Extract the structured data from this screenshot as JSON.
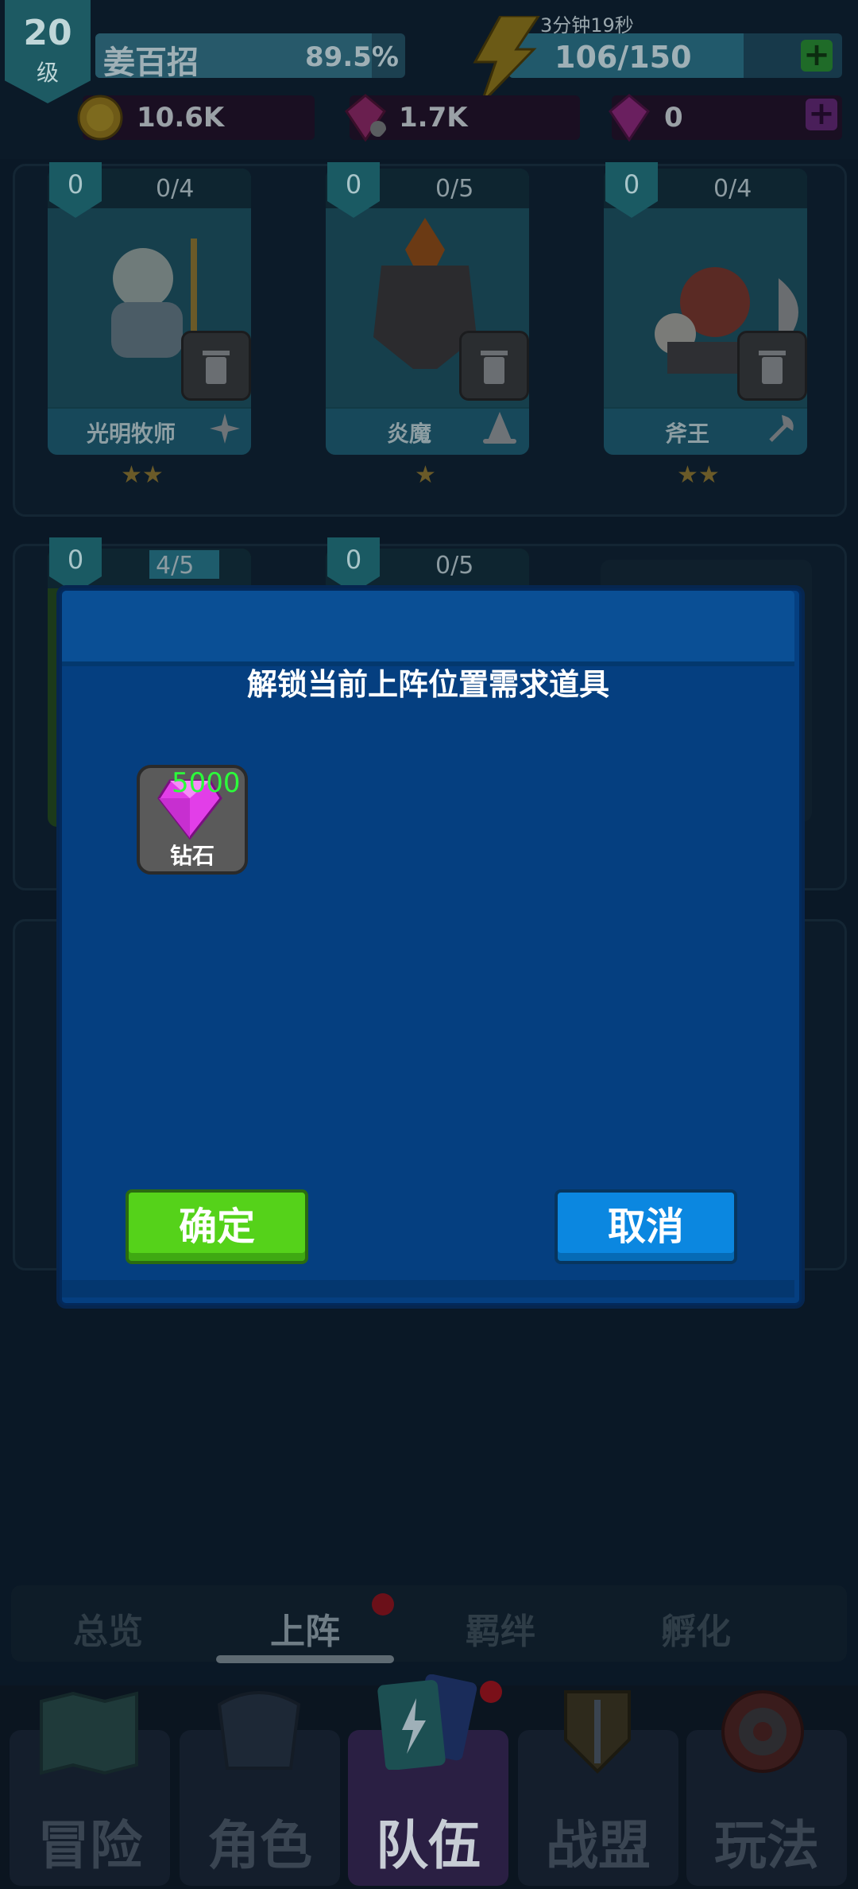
{
  "player": {
    "level": "20",
    "level_unit": "级",
    "name": "姜百招",
    "exp_percent": "89.5%",
    "exp_fraction": 0.895
  },
  "stamina": {
    "timer": "3分钟19秒",
    "value": "106/150",
    "fraction": 0.7067
  },
  "resources": [
    {
      "icon": "gold-coin-icon",
      "value": "10.6K"
    },
    {
      "icon": "locked-gem-icon",
      "value": "1.7K"
    },
    {
      "icon": "gem-icon",
      "value": "0"
    }
  ],
  "heroes_row1": [
    {
      "level": "0",
      "fragments": "0/4",
      "name": "光明牧师",
      "class_icon": "sparkle-class-icon",
      "stars": 2
    },
    {
      "level": "0",
      "fragments": "0/5",
      "name": "炎魔",
      "class_icon": "wizard-hat-class-icon",
      "stars": 1
    },
    {
      "level": "0",
      "fragments": "0/4",
      "name": "斧王",
      "class_icon": "axe-class-icon",
      "stars": 2
    }
  ],
  "heroes_row2": [
    {
      "level": "0",
      "fragments": "4/5"
    },
    {
      "level": "0",
      "fragments": "0/5"
    }
  ],
  "modal": {
    "title": "解锁当前上阵位置需求道具",
    "item": {
      "quantity": "5000",
      "name": "钻石",
      "icon": "diamond-icon"
    },
    "confirm_label": "确定",
    "cancel_label": "取消"
  },
  "tabs": [
    {
      "label": "总览",
      "active": false
    },
    {
      "label": "上阵",
      "active": true
    },
    {
      "label": "羁绊",
      "active": false
    },
    {
      "label": "孵化",
      "active": false
    }
  ],
  "nav": [
    {
      "label": "冒险",
      "icon": "map-icon",
      "active": false
    },
    {
      "label": "角色",
      "icon": "armor-icon",
      "active": false
    },
    {
      "label": "队伍",
      "icon": "cards-icon",
      "active": true
    },
    {
      "label": "战盟",
      "icon": "shield-sword-icon",
      "active": false
    },
    {
      "label": "玩法",
      "icon": "target-icon",
      "active": false
    }
  ],
  "colors": {
    "modal_bg": "#053f80",
    "confirm": "#55d21a",
    "cancel": "#0b87e0",
    "item_qty": "#2bff3a"
  }
}
